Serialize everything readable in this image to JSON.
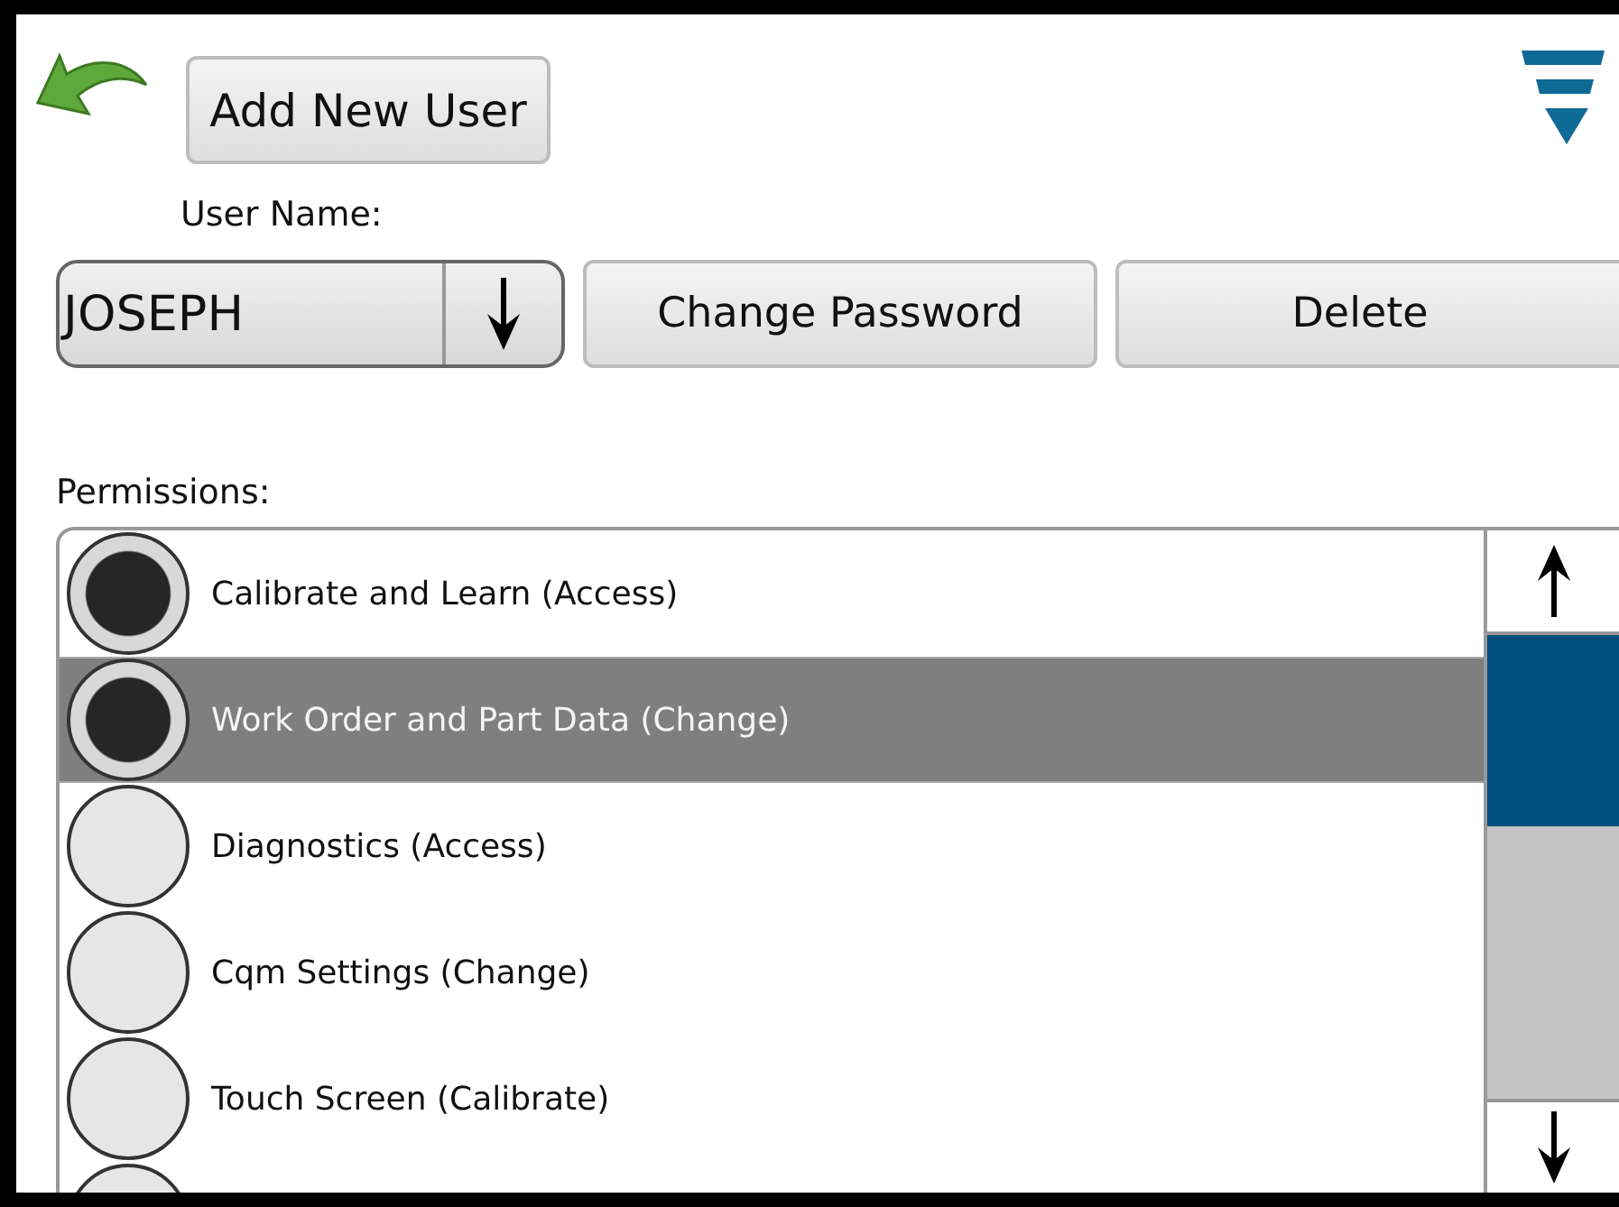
{
  "toolbar": {
    "add_button": "Add New User"
  },
  "user": {
    "label": "User Name:",
    "value": "JOSEPH",
    "change_password_button": "Change Password",
    "delete_button": "Delete"
  },
  "permissions": {
    "label": "Permissions:",
    "items": [
      {
        "label": "Calibrate and Learn (Access)",
        "checked": true,
        "selected": false
      },
      {
        "label": "Work Order and Part Data (Change)",
        "checked": true,
        "selected": true
      },
      {
        "label": "Diagnostics (Access)",
        "checked": false,
        "selected": false
      },
      {
        "label": "Cqm Settings (Change)",
        "checked": false,
        "selected": false
      },
      {
        "label": "Touch Screen (Calibrate)",
        "checked": false,
        "selected": false
      },
      {
        "checked": false,
        "selected": false
      }
    ]
  }
}
